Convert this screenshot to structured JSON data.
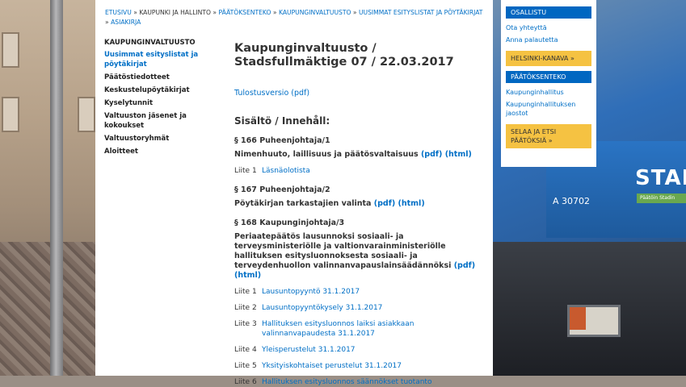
{
  "breadcrumb": {
    "items": [
      "Etusivu",
      "Kaupunki ja hallinto",
      "Päätöksenteko",
      "Kaupunginvaltuusto",
      "Uusimmat esityslistat ja pöytäkirjat",
      "Asiakirja"
    ],
    "separator": "»"
  },
  "left_nav": {
    "items": [
      "KAUPUNGINVALTUUSTO",
      "Uusimmat esityslistat ja pöytäkirjat",
      "Päätöstiedotteet",
      "Keskustelupöytäkirjat",
      "Kyselytunnit",
      "Valtuuston jäsenet ja kokoukset",
      "Valtuustoryhmät",
      "Aloitteet"
    ],
    "active_index": 1
  },
  "main": {
    "title": "Kaupunginvaltuusto / Stadsfullmäktige 07 / 22.03.2017",
    "print_link": "Tulostusversio (pdf)",
    "contents_heading": "Sisältö / Innehåll:",
    "sections": [
      {
        "heading": "§ 166 Puheenjohtaja/1",
        "desc": "Nimenhuuto, laillisuus ja päätösvaltaisuus",
        "pdf": "(pdf)",
        "html": "(html)",
        "attachments": [
          {
            "label": "Liite 1",
            "title": "Läsnäolotista"
          }
        ]
      },
      {
        "heading": "§ 167 Puheenjohtaja/2",
        "desc": "Pöytäkirjan tarkastajien valinta",
        "pdf": "(pdf)",
        "html": "(html)",
        "attachments": []
      },
      {
        "heading": "§ 168 Kaupunginjohtaja/3",
        "desc": "Periaatepäätös lausunnoksi sosiaali- ja terveysministeriölle ja valtionvarainministeriölle hallituksen esitysluonnoksesta sosiaali- ja terveydenhuollon valinnanvapauslainsäädännöksi",
        "pdf": "(pdf)",
        "html": "(html)",
        "attachments": [
          {
            "label": "Liite 1",
            "title": "Lausuntopyyntö 31.1.2017"
          },
          {
            "label": "Liite 2",
            "title": "Lausuntopyyntökysely 31.1.2017"
          },
          {
            "label": "Liite 3",
            "title": "Hallituksen esitysluonnos laiksi asiakkaan valinnanvapaudesta 31.1.2017"
          },
          {
            "label": "Liite 4",
            "title": "Yleisperustelut 31.1.2017"
          },
          {
            "label": "Liite 5",
            "title": "Yksityiskohtaiset perustelut 31.1.2017"
          },
          {
            "label": "Liite 6",
            "title": "Hallituksen esitysluonnos säännökset tuotanto"
          }
        ]
      }
    ]
  },
  "widgets": {
    "osallistu_head": "OSALLISTU",
    "osallistu_links": [
      "Ota yhteyttä",
      "Anna palautetta"
    ],
    "kanava": "HELSINKI-KANAVA »",
    "paatos_head": "PÄÄTÖKSENTEKO",
    "paatos_links": [
      "Kaupunginhallitus",
      "Kaupunginhallituksen jaostot"
    ],
    "selaa": "SELAA JA ETSI PÄÄTÖKSIÄ »"
  },
  "background": {
    "truck_text": "STAR",
    "truck_number": "A 30702",
    "truck_green_text": "Päätöin Stadin"
  },
  "colors": {
    "link": "#006fc6",
    "head_blue": "#0067c1",
    "yellow": "#f5c242"
  }
}
